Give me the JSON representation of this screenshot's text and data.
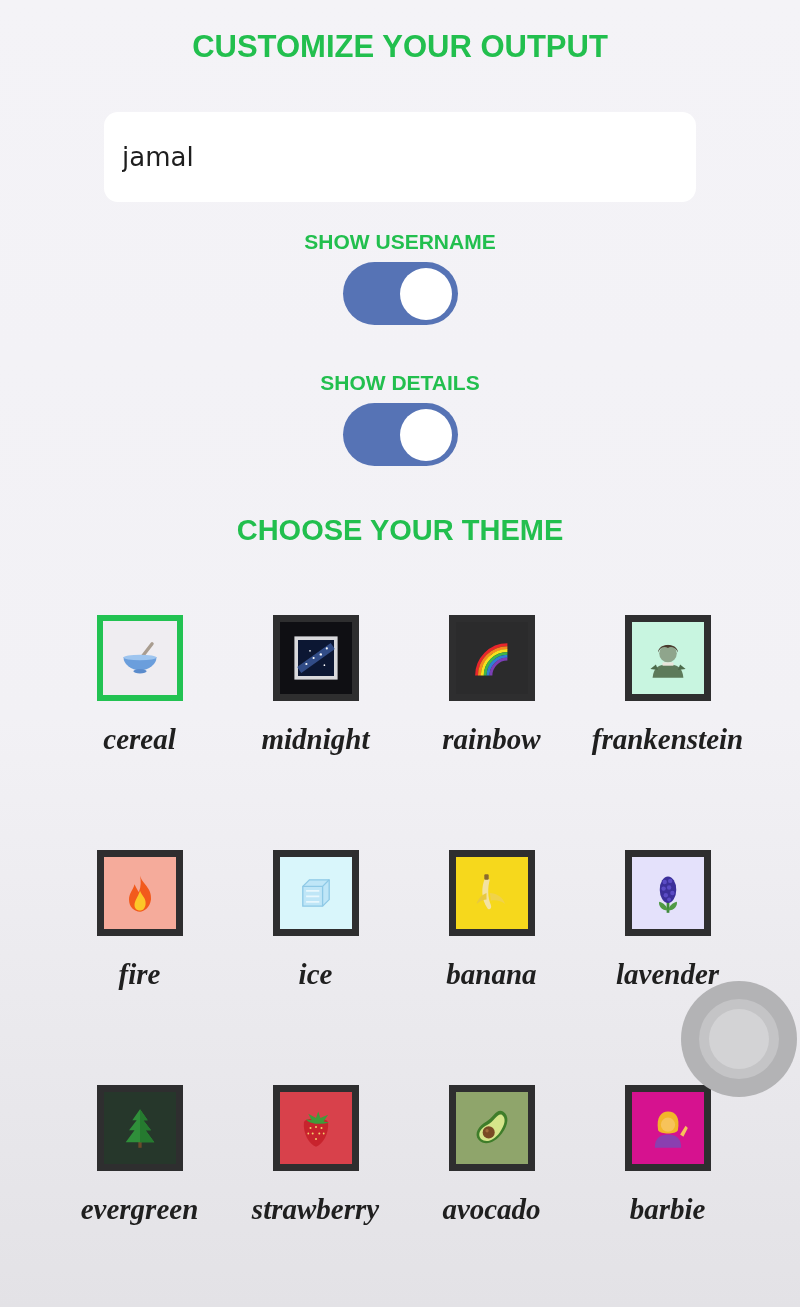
{
  "title": "CUSTOMIZE YOUR OUTPUT",
  "name_field": {
    "value": "jamal"
  },
  "toggles": [
    {
      "label": "SHOW USERNAME",
      "on": true
    },
    {
      "label": "SHOW DETAILS",
      "on": true
    }
  ],
  "theme_section": {
    "title": "CHOOSE YOUR THEME"
  },
  "themes": [
    {
      "label": "cereal",
      "color": "#efedf1",
      "selected": true
    },
    {
      "label": "midnight",
      "color": "#0f0f13",
      "selected": false
    },
    {
      "label": "rainbow",
      "color": "#2b2b2c",
      "selected": false
    },
    {
      "label": "frankenstein",
      "color": "#c8f5e0",
      "selected": false
    },
    {
      "label": "fire",
      "color": "#f5ab9b",
      "selected": false
    },
    {
      "label": "ice",
      "color": "#d9f6fb",
      "selected": false
    },
    {
      "label": "banana",
      "color": "#f6d81c",
      "selected": false
    },
    {
      "label": "lavender",
      "color": "#e4e1fb",
      "selected": false
    },
    {
      "label": "evergreen",
      "color": "#26372b",
      "selected": false
    },
    {
      "label": "strawberry",
      "color": "#d8414b",
      "selected": false
    },
    {
      "label": "avocado",
      "color": "#8fa56b",
      "selected": false
    },
    {
      "label": "barbie",
      "color": "#d6128f",
      "selected": false
    }
  ]
}
